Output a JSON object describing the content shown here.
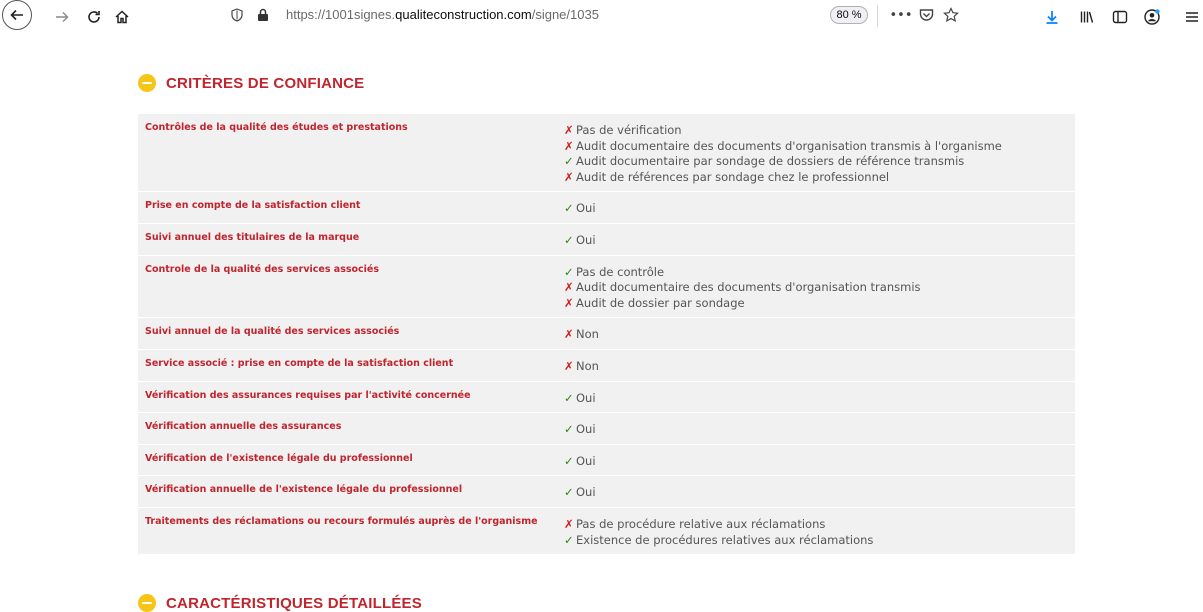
{
  "browser": {
    "url_prefix": "https://1001signes.",
    "url_domain": "qualiteconstruction.com",
    "url_path": "/signe/1035",
    "zoom": "80 %",
    "menu_dots": "•••",
    "icons": [
      "back-icon",
      "forward-icon",
      "reload-icon",
      "home-icon",
      "shield-icon",
      "lock-icon",
      "page-actions-icon",
      "pocket-icon",
      "bookmark-star-icon",
      "download-icon",
      "library-icon",
      "sidebar-icon",
      "account-icon",
      "menu-icon"
    ]
  },
  "sections": {
    "trust": {
      "title": "CRITÈRES DE CONFIANCE"
    },
    "details": {
      "title": "CARACTÉRISTIQUES DÉTAILLÉES"
    }
  },
  "marks": {
    "yes": "✓",
    "no": "✗"
  },
  "colors": {
    "accent_red": "#c0252e",
    "bullet_yellow": "#f6c516",
    "yes_green": "#2b8a12",
    "no_red": "#d21d1d",
    "row_bg": "#f1f1f1"
  },
  "criteria": [
    {
      "label": "Contrôles de la qualité des études et prestations",
      "values": [
        {
          "ok": false,
          "text": "Pas de vérification"
        },
        {
          "ok": false,
          "text": "Audit documentaire des documents d'organisation transmis à l'organisme"
        },
        {
          "ok": true,
          "text": "Audit documentaire par sondage de dossiers de référence transmis"
        },
        {
          "ok": false,
          "text": "Audit de références par sondage chez le professionnel"
        }
      ]
    },
    {
      "label": "Prise en compte de la satisfaction client",
      "values": [
        {
          "ok": true,
          "text": "Oui"
        }
      ]
    },
    {
      "label": "Suivi annuel des titulaires de la marque",
      "values": [
        {
          "ok": true,
          "text": "Oui"
        }
      ]
    },
    {
      "label": "Controle de la qualité des services associés",
      "values": [
        {
          "ok": true,
          "text": "Pas de contrôle"
        },
        {
          "ok": false,
          "text": "Audit documentaire des documents d'organisation transmis"
        },
        {
          "ok": false,
          "text": "Audit de dossier par sondage"
        }
      ]
    },
    {
      "label": "Suivi annuel de la qualité des services associés",
      "values": [
        {
          "ok": false,
          "text": "Non"
        }
      ]
    },
    {
      "label": "Service associé : prise en compte de la satisfaction client",
      "values": [
        {
          "ok": false,
          "text": "Non"
        }
      ]
    },
    {
      "label": "Vérification des assurances requises par l'activité concernée",
      "values": [
        {
          "ok": true,
          "text": "Oui"
        }
      ]
    },
    {
      "label": "Vérification annuelle des assurances",
      "values": [
        {
          "ok": true,
          "text": "Oui"
        }
      ]
    },
    {
      "label": "Vérification de l'existence légale du professionnel",
      "values": [
        {
          "ok": true,
          "text": "Oui"
        }
      ]
    },
    {
      "label": "Vérification annuelle de l'existence légale du professionnel",
      "values": [
        {
          "ok": true,
          "text": "Oui"
        }
      ]
    },
    {
      "label": "Traitements des réclamations ou recours formulés auprès de l'organisme",
      "values": [
        {
          "ok": false,
          "text": "Pas de procédure relative aux réclamations"
        },
        {
          "ok": true,
          "text": "Existence de procédures relatives aux réclamations"
        }
      ]
    }
  ]
}
